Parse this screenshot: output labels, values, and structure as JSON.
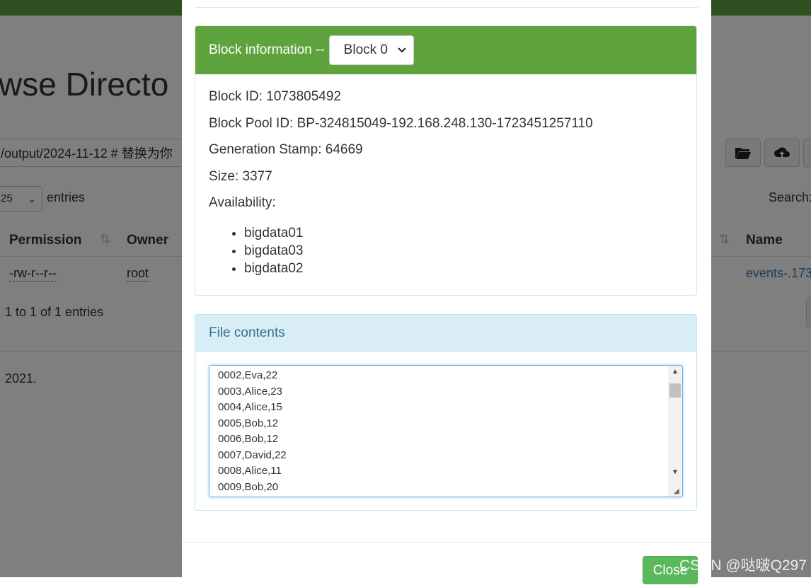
{
  "background": {
    "title": "wse Directo",
    "path_value": "/output/2024-11-12 # 替换为你",
    "entries_select": "25",
    "entries_label": "entries",
    "search_label": "Search:",
    "columns": {
      "permission": "Permission",
      "owner": "Owner",
      "name": "Name"
    },
    "row": {
      "permission": "-rw-r--r--",
      "owner": "root",
      "name": "events-.173"
    },
    "showing": "1 to 1 of 1 entries",
    "footer": "2021."
  },
  "modal": {
    "block_panel": {
      "title": "Block information --",
      "selected_block": "Block 0",
      "block_id": "Block ID: 1073805492",
      "block_pool_id": "Block Pool ID: BP-324815049-192.168.248.130-1723451257110",
      "generation_stamp": "Generation Stamp: 64669",
      "size": "Size: 3377",
      "availability_label": "Availability:",
      "availability": [
        "bigdata01",
        "bigdata03",
        "bigdata02"
      ]
    },
    "contents_panel": {
      "title": "File contents",
      "lines": [
        "0002,Eva,22",
        "0003,Alice,23",
        "0004,Alice,15",
        "0005,Bob,12",
        "0006,Bob,12",
        "0007,David,22",
        "0008,Alice,11",
        "0009,Bob,20"
      ]
    },
    "close_label": "Close"
  },
  "watermark": "CSDN @哒啵Q297",
  "colors": {
    "green": "#5fa33e",
    "info_bg": "#d9edf7",
    "info_text": "#31708f",
    "link": "#337ab7"
  }
}
